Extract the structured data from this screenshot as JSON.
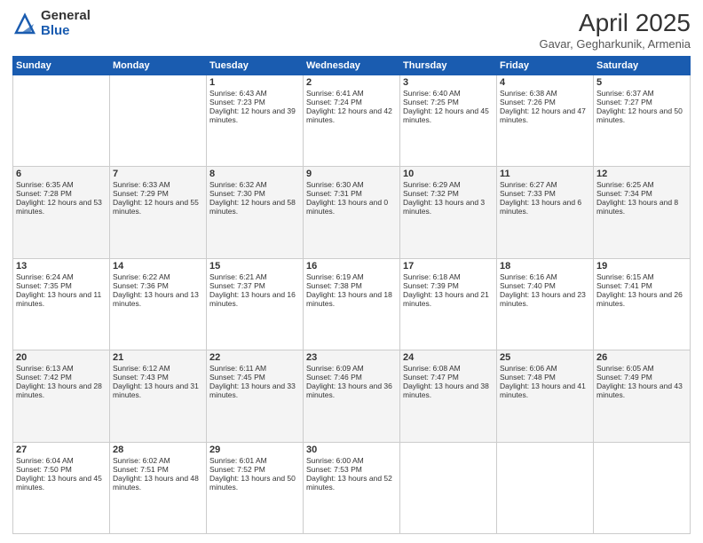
{
  "header": {
    "logo_general": "General",
    "logo_blue": "Blue",
    "title": "April 2025",
    "location": "Gavar, Gegharkunik, Armenia"
  },
  "weekdays": [
    "Sunday",
    "Monday",
    "Tuesday",
    "Wednesday",
    "Thursday",
    "Friday",
    "Saturday"
  ],
  "weeks": [
    [
      {
        "day": "",
        "info": ""
      },
      {
        "day": "",
        "info": ""
      },
      {
        "day": "1",
        "sunrise": "Sunrise: 6:43 AM",
        "sunset": "Sunset: 7:23 PM",
        "daylight": "Daylight: 12 hours and 39 minutes."
      },
      {
        "day": "2",
        "sunrise": "Sunrise: 6:41 AM",
        "sunset": "Sunset: 7:24 PM",
        "daylight": "Daylight: 12 hours and 42 minutes."
      },
      {
        "day": "3",
        "sunrise": "Sunrise: 6:40 AM",
        "sunset": "Sunset: 7:25 PM",
        "daylight": "Daylight: 12 hours and 45 minutes."
      },
      {
        "day": "4",
        "sunrise": "Sunrise: 6:38 AM",
        "sunset": "Sunset: 7:26 PM",
        "daylight": "Daylight: 12 hours and 47 minutes."
      },
      {
        "day": "5",
        "sunrise": "Sunrise: 6:37 AM",
        "sunset": "Sunset: 7:27 PM",
        "daylight": "Daylight: 12 hours and 50 minutes."
      }
    ],
    [
      {
        "day": "6",
        "sunrise": "Sunrise: 6:35 AM",
        "sunset": "Sunset: 7:28 PM",
        "daylight": "Daylight: 12 hours and 53 minutes."
      },
      {
        "day": "7",
        "sunrise": "Sunrise: 6:33 AM",
        "sunset": "Sunset: 7:29 PM",
        "daylight": "Daylight: 12 hours and 55 minutes."
      },
      {
        "day": "8",
        "sunrise": "Sunrise: 6:32 AM",
        "sunset": "Sunset: 7:30 PM",
        "daylight": "Daylight: 12 hours and 58 minutes."
      },
      {
        "day": "9",
        "sunrise": "Sunrise: 6:30 AM",
        "sunset": "Sunset: 7:31 PM",
        "daylight": "Daylight: 13 hours and 0 minutes."
      },
      {
        "day": "10",
        "sunrise": "Sunrise: 6:29 AM",
        "sunset": "Sunset: 7:32 PM",
        "daylight": "Daylight: 13 hours and 3 minutes."
      },
      {
        "day": "11",
        "sunrise": "Sunrise: 6:27 AM",
        "sunset": "Sunset: 7:33 PM",
        "daylight": "Daylight: 13 hours and 6 minutes."
      },
      {
        "day": "12",
        "sunrise": "Sunrise: 6:25 AM",
        "sunset": "Sunset: 7:34 PM",
        "daylight": "Daylight: 13 hours and 8 minutes."
      }
    ],
    [
      {
        "day": "13",
        "sunrise": "Sunrise: 6:24 AM",
        "sunset": "Sunset: 7:35 PM",
        "daylight": "Daylight: 13 hours and 11 minutes."
      },
      {
        "day": "14",
        "sunrise": "Sunrise: 6:22 AM",
        "sunset": "Sunset: 7:36 PM",
        "daylight": "Daylight: 13 hours and 13 minutes."
      },
      {
        "day": "15",
        "sunrise": "Sunrise: 6:21 AM",
        "sunset": "Sunset: 7:37 PM",
        "daylight": "Daylight: 13 hours and 16 minutes."
      },
      {
        "day": "16",
        "sunrise": "Sunrise: 6:19 AM",
        "sunset": "Sunset: 7:38 PM",
        "daylight": "Daylight: 13 hours and 18 minutes."
      },
      {
        "day": "17",
        "sunrise": "Sunrise: 6:18 AM",
        "sunset": "Sunset: 7:39 PM",
        "daylight": "Daylight: 13 hours and 21 minutes."
      },
      {
        "day": "18",
        "sunrise": "Sunrise: 6:16 AM",
        "sunset": "Sunset: 7:40 PM",
        "daylight": "Daylight: 13 hours and 23 minutes."
      },
      {
        "day": "19",
        "sunrise": "Sunrise: 6:15 AM",
        "sunset": "Sunset: 7:41 PM",
        "daylight": "Daylight: 13 hours and 26 minutes."
      }
    ],
    [
      {
        "day": "20",
        "sunrise": "Sunrise: 6:13 AM",
        "sunset": "Sunset: 7:42 PM",
        "daylight": "Daylight: 13 hours and 28 minutes."
      },
      {
        "day": "21",
        "sunrise": "Sunrise: 6:12 AM",
        "sunset": "Sunset: 7:43 PM",
        "daylight": "Daylight: 13 hours and 31 minutes."
      },
      {
        "day": "22",
        "sunrise": "Sunrise: 6:11 AM",
        "sunset": "Sunset: 7:45 PM",
        "daylight": "Daylight: 13 hours and 33 minutes."
      },
      {
        "day": "23",
        "sunrise": "Sunrise: 6:09 AM",
        "sunset": "Sunset: 7:46 PM",
        "daylight": "Daylight: 13 hours and 36 minutes."
      },
      {
        "day": "24",
        "sunrise": "Sunrise: 6:08 AM",
        "sunset": "Sunset: 7:47 PM",
        "daylight": "Daylight: 13 hours and 38 minutes."
      },
      {
        "day": "25",
        "sunrise": "Sunrise: 6:06 AM",
        "sunset": "Sunset: 7:48 PM",
        "daylight": "Daylight: 13 hours and 41 minutes."
      },
      {
        "day": "26",
        "sunrise": "Sunrise: 6:05 AM",
        "sunset": "Sunset: 7:49 PM",
        "daylight": "Daylight: 13 hours and 43 minutes."
      }
    ],
    [
      {
        "day": "27",
        "sunrise": "Sunrise: 6:04 AM",
        "sunset": "Sunset: 7:50 PM",
        "daylight": "Daylight: 13 hours and 45 minutes."
      },
      {
        "day": "28",
        "sunrise": "Sunrise: 6:02 AM",
        "sunset": "Sunset: 7:51 PM",
        "daylight": "Daylight: 13 hours and 48 minutes."
      },
      {
        "day": "29",
        "sunrise": "Sunrise: 6:01 AM",
        "sunset": "Sunset: 7:52 PM",
        "daylight": "Daylight: 13 hours and 50 minutes."
      },
      {
        "day": "30",
        "sunrise": "Sunrise: 6:00 AM",
        "sunset": "Sunset: 7:53 PM",
        "daylight": "Daylight: 13 hours and 52 minutes."
      },
      {
        "day": "",
        "info": ""
      },
      {
        "day": "",
        "info": ""
      },
      {
        "day": "",
        "info": ""
      }
    ]
  ]
}
